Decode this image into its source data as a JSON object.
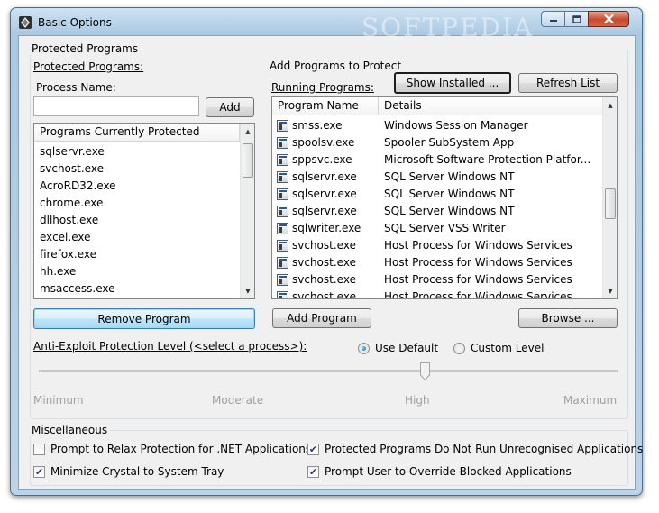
{
  "window": {
    "title": "Basic Options"
  },
  "protected_group": {
    "label": "Protected Programs",
    "section_label": "Protected Programs:",
    "process_name_label": "Process Name:",
    "process_name_value": "",
    "add_label": "Add",
    "list_header": "Programs Currently Protected",
    "items": [
      "sqlservr.exe",
      "svchost.exe",
      "AcroRD32.exe",
      "chrome.exe",
      "dllhost.exe",
      "excel.exe",
      "firefox.exe",
      "hh.exe",
      "msaccess.exe"
    ],
    "remove_label": "Remove Program"
  },
  "add_group": {
    "label": "Add Programs to Protect",
    "running_label": "Running Programs:",
    "show_installed_label": "Show Installed ...",
    "refresh_label": "Refresh List",
    "columns": [
      "Program Name",
      "Details"
    ],
    "rows": [
      {
        "name": "smss.exe",
        "details": "Windows Session Manager"
      },
      {
        "name": "spoolsv.exe",
        "details": "Spooler SubSystem App"
      },
      {
        "name": "sppsvc.exe",
        "details": "Microsoft Software Protection Platfor..."
      },
      {
        "name": "sqlservr.exe",
        "details": "SQL Server Windows NT"
      },
      {
        "name": "sqlservr.exe",
        "details": "SQL Server Windows NT"
      },
      {
        "name": "sqlservr.exe",
        "details": "SQL Server Windows NT"
      },
      {
        "name": "sqlwriter.exe",
        "details": "SQL Server VSS Writer"
      },
      {
        "name": "svchost.exe",
        "details": "Host Process for Windows Services"
      },
      {
        "name": "svchost.exe",
        "details": "Host Process for Windows Services"
      },
      {
        "name": "svchost.exe",
        "details": "Host Process for Windows Services"
      },
      {
        "name": "svchost.exe",
        "details": "Host Process for Windows Services"
      }
    ],
    "add_program_label": "Add Program",
    "browse_label": "Browse ..."
  },
  "protection": {
    "label": "Anti-Exploit Protection Level (<select a process>):",
    "use_default_label": "Use Default",
    "custom_level_label": "Custom Level",
    "selected": "Use Default",
    "levels": [
      "Minimum",
      "Moderate",
      "High",
      "Maximum"
    ],
    "current_level": "High"
  },
  "misc": {
    "label": "Miscellaneous",
    "options": [
      {
        "label": "Prompt to Relax Protection for .NET Applications",
        "checked": false
      },
      {
        "label": "Protected Programs Do Not Run Unrecognised Applications",
        "checked": true
      },
      {
        "label": "Minimize Crystal to System Tray",
        "checked": true
      },
      {
        "label": "Prompt User to Override Blocked Applications",
        "checked": true
      }
    ]
  },
  "watermark": "SOFTPEDIA",
  "colors": {
    "accent": "#3c7fb1",
    "titlebar": "#bcd3e8",
    "close": "#c44b2e",
    "client": "#f0f0f0"
  }
}
